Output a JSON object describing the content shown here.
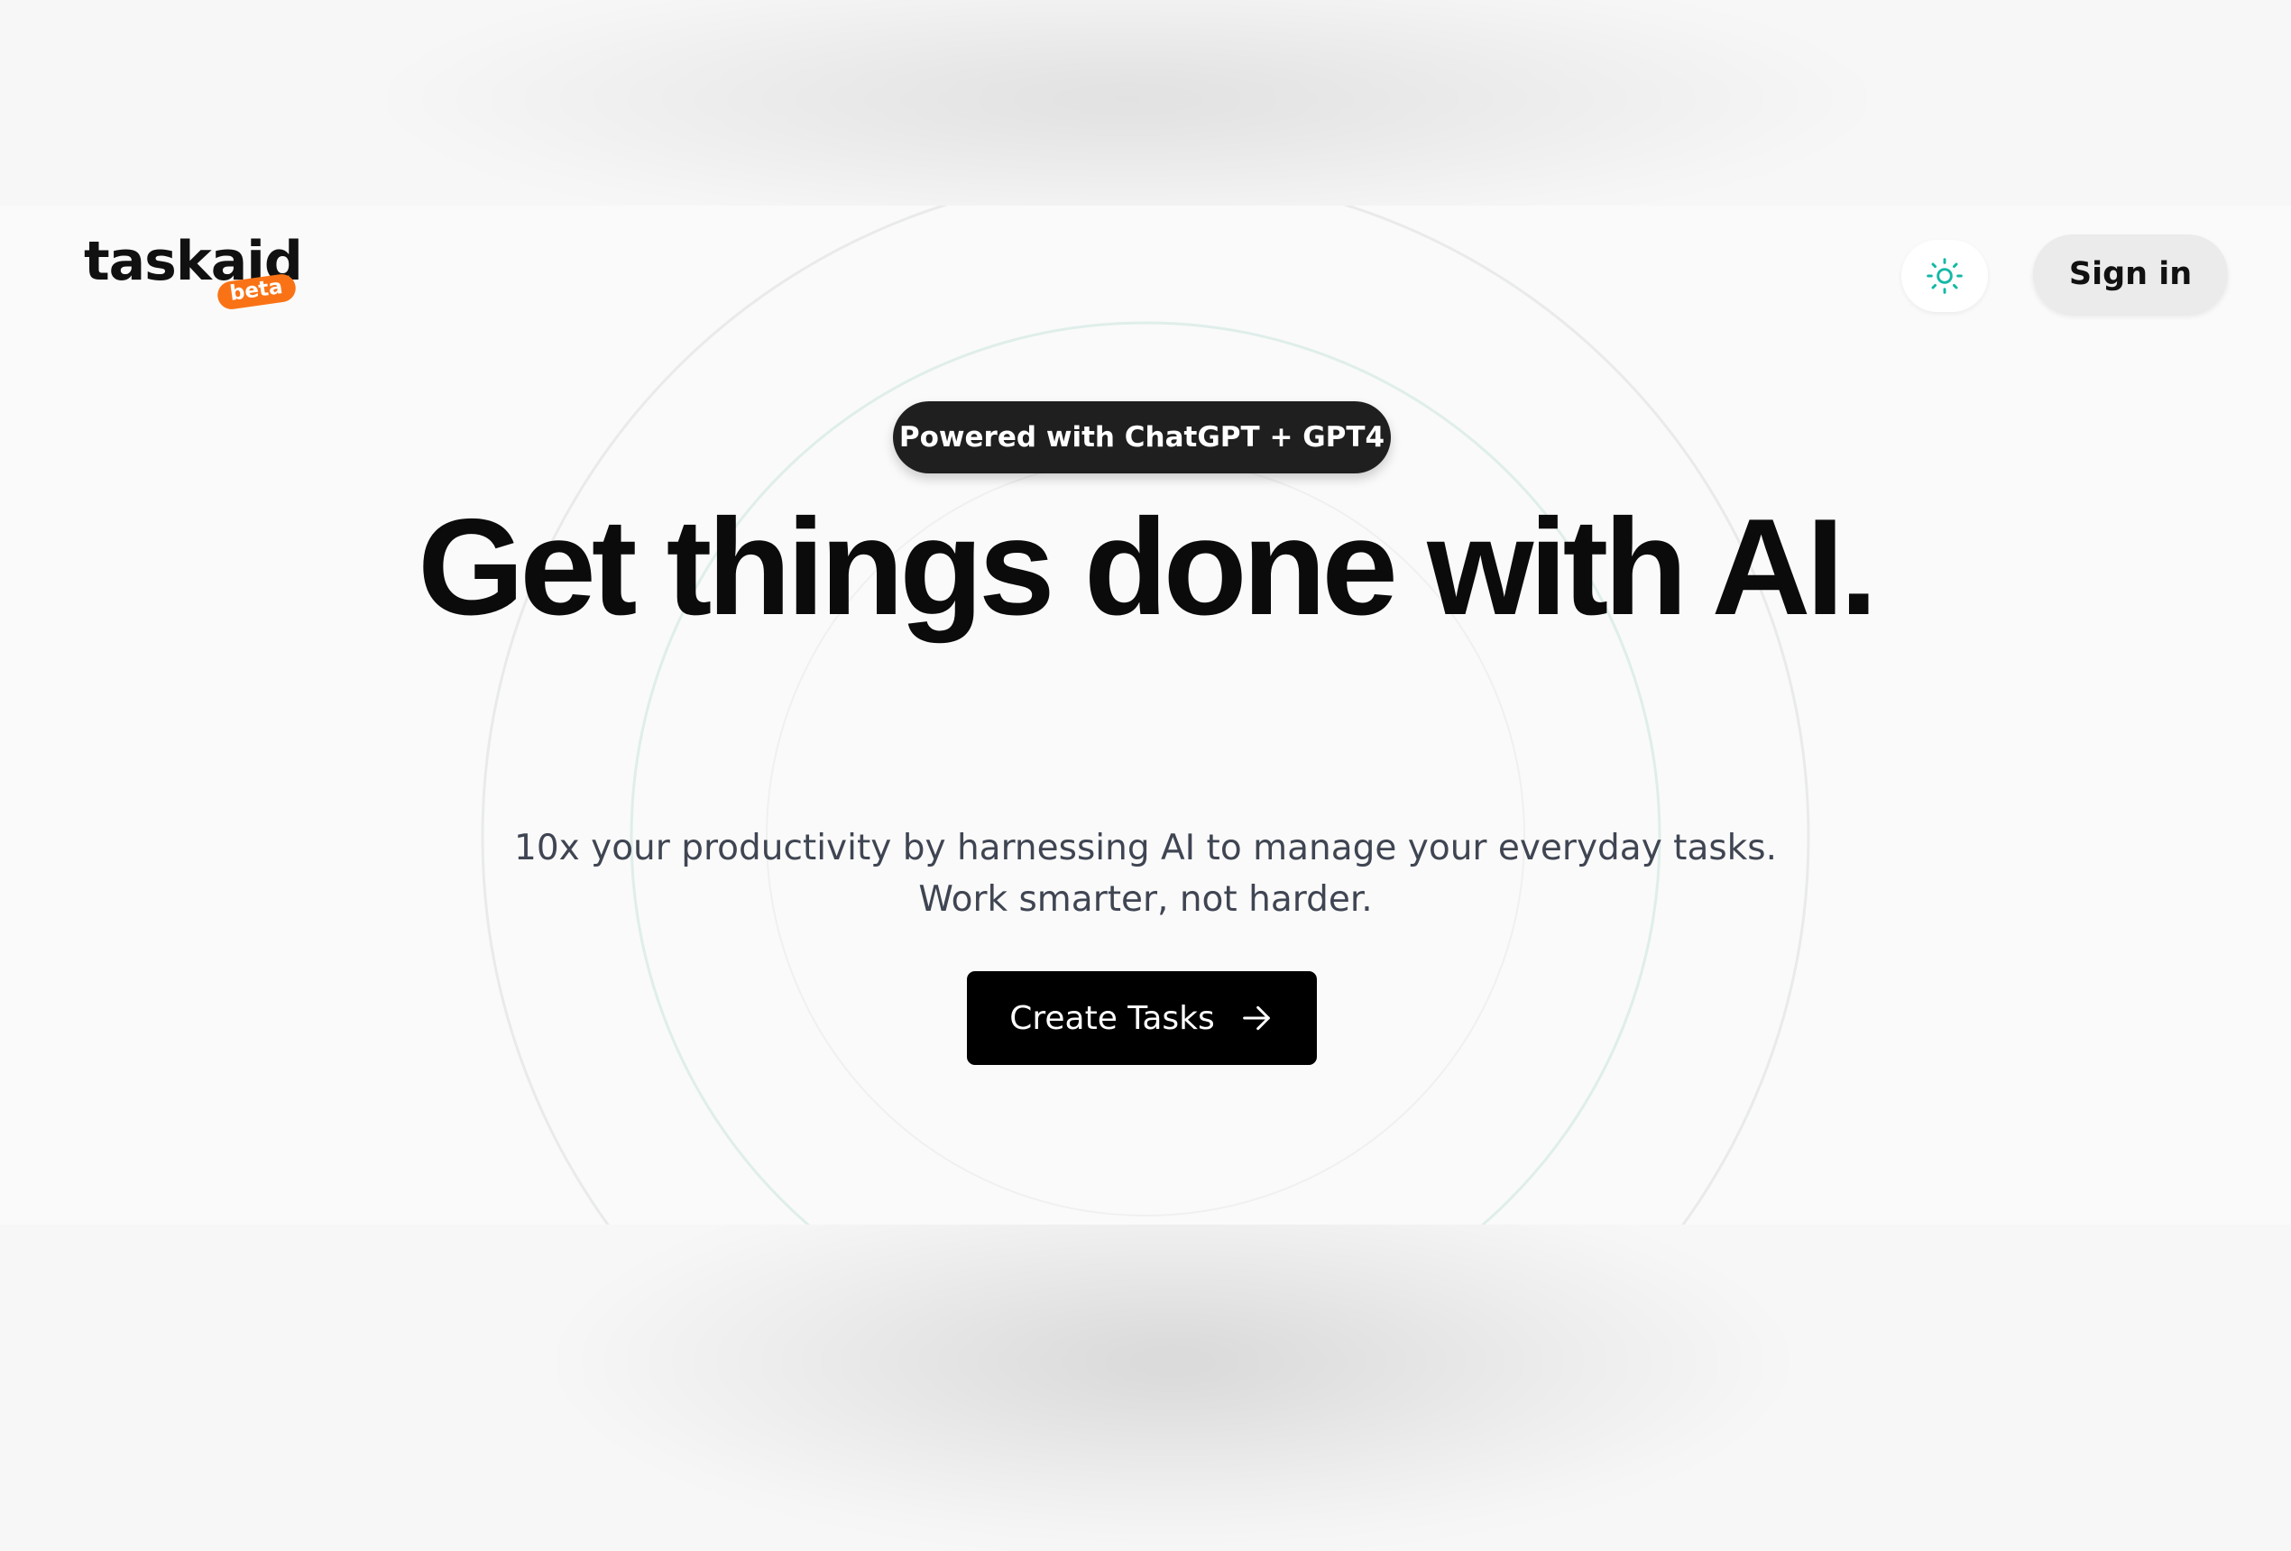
{
  "header": {
    "logo_text": "taskaid",
    "beta_label": "beta",
    "theme_icon": "sun-icon",
    "sign_in_label": "Sign in"
  },
  "hero": {
    "badge": "Powered with ChatGPT + GPT4",
    "headline": "Get things done with AI.",
    "subtitle": "10x your productivity by harnessing AI to manage your everyday tasks. Work smarter, not harder.",
    "cta_label": "Create Tasks",
    "cta_icon": "arrow-right-icon"
  },
  "colors": {
    "accent_orange": "#f97316",
    "sun_icon_teal": "#14b8a6",
    "dark_button": "#000000",
    "pill_background": "#1f1f1f"
  }
}
